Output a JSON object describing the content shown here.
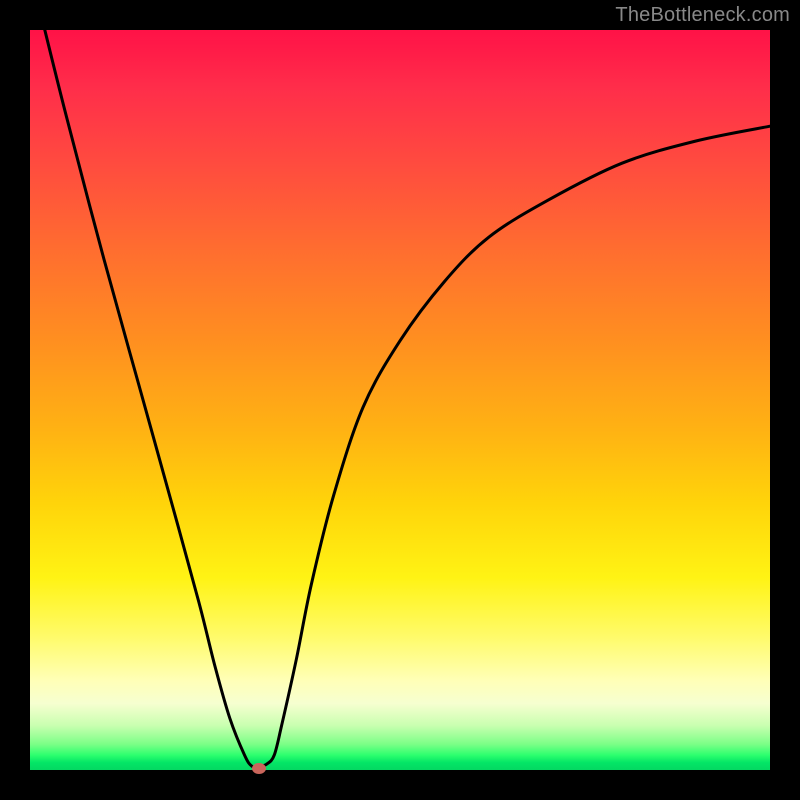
{
  "watermark": "TheBottleneck.com",
  "chart_data": {
    "type": "line",
    "title": "",
    "xlabel": "",
    "ylabel": "",
    "xlim": [
      0,
      100
    ],
    "ylim": [
      0,
      100
    ],
    "grid": false,
    "legend": false,
    "series": [
      {
        "name": "curve",
        "x": [
          2,
          5,
          10,
          15,
          20,
          23,
          25,
          27,
          29,
          30,
          31,
          32,
          33,
          34,
          36,
          38,
          41,
          45,
          50,
          56,
          62,
          70,
          80,
          90,
          100
        ],
        "y": [
          100,
          88,
          69,
          51,
          33,
          22,
          14,
          7,
          2,
          0.5,
          0.5,
          0.8,
          2,
          6,
          15,
          25,
          37,
          49,
          58,
          66,
          72,
          77,
          82,
          85,
          87
        ]
      }
    ],
    "marker": {
      "x": 31,
      "y": 0.3
    },
    "colors": {
      "curve": "#000000",
      "marker": "#c9655b",
      "gradient_top": "#ff1247",
      "gradient_bottom": "#04d862"
    }
  }
}
